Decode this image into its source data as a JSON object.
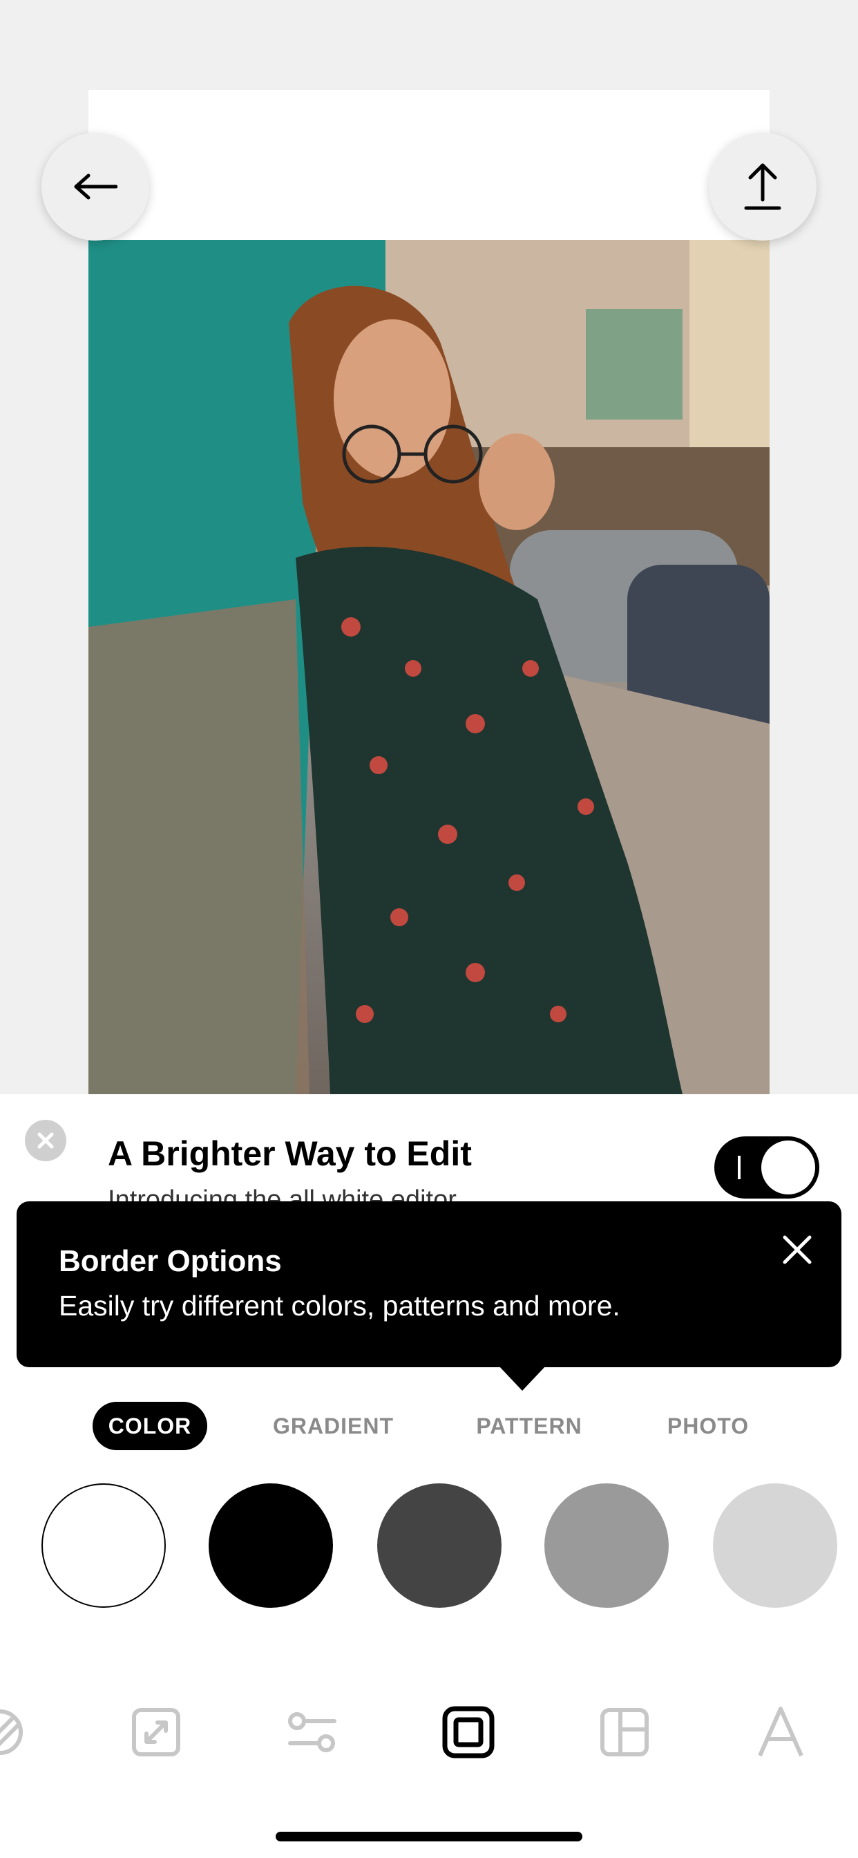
{
  "promo": {
    "title": "A Brighter Way to Edit",
    "subtitle": "Introducing the all white editor",
    "toggle_on": true
  },
  "tooltip": {
    "title": "Border Options",
    "body": "Easily try different colors, patterns and more."
  },
  "tabs": [
    {
      "label": "COLOR",
      "active": true
    },
    {
      "label": "GRADIENT",
      "active": false
    },
    {
      "label": "PATTERN",
      "active": false
    },
    {
      "label": "PHOTO",
      "active": false
    }
  ],
  "swatches": [
    {
      "name": "white",
      "color": "#ffffff"
    },
    {
      "name": "black",
      "color": "#000000"
    },
    {
      "name": "dark-gray",
      "color": "#444444"
    },
    {
      "name": "gray",
      "color": "#9a9a9a"
    },
    {
      "name": "light-gray",
      "color": "#d6d6d6"
    }
  ],
  "toolbar": {
    "items": [
      "filters-icon",
      "crop-icon",
      "adjust-icon",
      "border-icon",
      "layout-icon",
      "text-icon"
    ],
    "active": "border-icon"
  },
  "icons": {
    "back": "arrow-left-icon",
    "share": "share-upload-icon"
  }
}
